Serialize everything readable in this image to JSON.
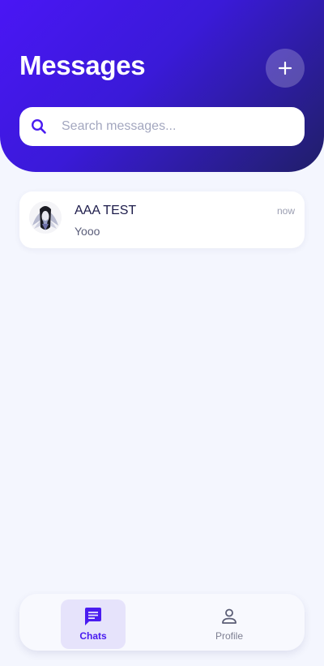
{
  "header": {
    "title": "Messages",
    "add_icon": "plus-icon"
  },
  "search": {
    "placeholder": "Search messages...",
    "icon": "search-icon"
  },
  "chats": [
    {
      "name": "AAA TEST",
      "preview": "Yooo",
      "time": "now"
    }
  ],
  "nav": {
    "items": [
      {
        "label": "Chats",
        "icon": "chat-bubble-icon",
        "active": true
      },
      {
        "label": "Profile",
        "icon": "person-icon",
        "active": false
      }
    ]
  },
  "colors": {
    "accent": "#4a1cf0",
    "header_gradient_start": "#4a16f5",
    "header_gradient_end": "#201f68",
    "background": "#f4f6fe"
  }
}
